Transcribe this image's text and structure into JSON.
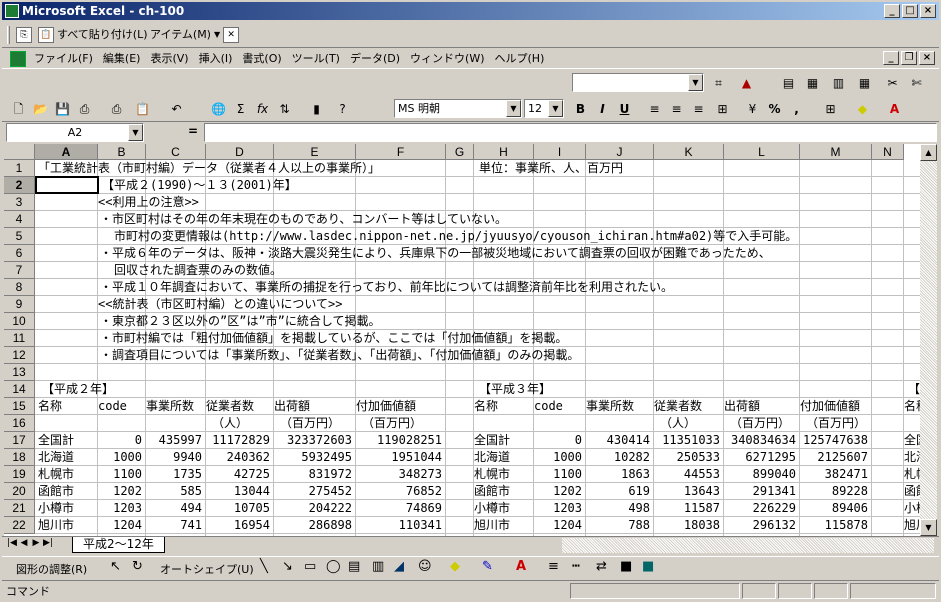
{
  "window": {
    "title": "Microsoft Excel - ch-100"
  },
  "clipboard_toolbar": {
    "paste_all": "すべて貼り付け(L)",
    "items": "アイテム(M)"
  },
  "menu": [
    "ファイル(F)",
    "編集(E)",
    "表示(V)",
    "挿入(I)",
    "書式(O)",
    "ツール(T)",
    "データ(D)",
    "ウィンドウ(W)",
    "ヘルプ(H)"
  ],
  "format_toolbar": {
    "font": "MS 明朝",
    "size": "12",
    "bold": "B",
    "italic": "I",
    "underline": "U",
    "percent": "%",
    "comma": ","
  },
  "formula_bar": {
    "name_box": "A2",
    "eq": "=",
    "value": ""
  },
  "columns": [
    "A",
    "B",
    "C",
    "D",
    "E",
    "F",
    "G",
    "H",
    "I",
    "J",
    "K",
    "L",
    "M",
    "N"
  ],
  "rows": [
    "1",
    "2",
    "3",
    "4",
    "5",
    "6",
    "7",
    "8",
    "9",
    "10",
    "11",
    "12",
    "13",
    "14",
    "15",
    "16",
    "17",
    "18",
    "19",
    "20",
    "21",
    "22"
  ],
  "text_lines": {
    "r1": "「工業統計表（市町村編）データ（従業者４人以上の事業所）」",
    "r1_unit": "単位：事業所、人、百万円",
    "r2": "【平成２(1990)～１３(2001)年】",
    "r3": "<<利用上の注意>>",
    "r4": "・市区町村はその年の年末現在のものであり、コンバート等はしていない。",
    "r5": "市町村の変更情報は(http://www.lasdec.nippon-net.ne.jp/jyuusyo/cyouson_ichiran.htm#a02)等で入手可能。",
    "r6": "・平成６年のデータは、阪神・淡路大震災発生により、兵庫県下の一部被災地域において調査票の回収が困難であったため、",
    "r7": "回収された調査票のみの数値。",
    "r8": "・平成１０年調査において、事業所の捕捉を行っており、前年比については調整済前年比を利用されたい。",
    "r9": "<<統計表（市区町村編）との違いについて>>",
    "r10": "・東京都２３区以外の”区”は”市”に統合して掲載。",
    "r11": "・市町村編では「粗付加価値額」を掲載しているが、ここでは「付加価値額」を掲載。",
    "r12": "・調査項目については「事業所数」、「従業者数」、「出荷額」、「付加価値額」のみの掲載。"
  },
  "block_h2": {
    "title": "【平成２年】",
    "headers": [
      "名称",
      "code",
      "事業所数",
      "従業者数",
      "出荷額",
      "付加価値額"
    ],
    "subheaders": [
      "",
      "",
      "",
      "（人）",
      "（百万円）",
      "（百万円）"
    ],
    "rows": [
      [
        "全国計",
        "0",
        "435997",
        "11172829",
        "323372603",
        "119028251"
      ],
      [
        "北海道",
        "1000",
        "9940",
        "240362",
        "5932495",
        "1951044"
      ],
      [
        "札幌市",
        "1100",
        "1735",
        "42725",
        "831972",
        "348273"
      ],
      [
        "函館市",
        "1202",
        "585",
        "13044",
        "275452",
        "76852"
      ],
      [
        "小樽市",
        "1203",
        "494",
        "10705",
        "204222",
        "74869"
      ],
      [
        "旭川市",
        "1204",
        "741",
        "16954",
        "286898",
        "110341"
      ]
    ]
  },
  "block_h3": {
    "title": "【平成３年】",
    "headers": [
      "名称",
      "code",
      "事業所数",
      "従業者数",
      "出荷額",
      "付加価値額",
      "名称"
    ],
    "subheaders": [
      "",
      "",
      "",
      "（人）",
      "（百万円）",
      "（百万円）"
    ],
    "rows": [
      [
        "全国計",
        "0",
        "430414",
        "11351033",
        "340834634",
        "125747638",
        "全国"
      ],
      [
        "北海道",
        "1000",
        "10282",
        "250533",
        "6271295",
        "2125607",
        "北海"
      ],
      [
        "札幌市",
        "1100",
        "1863",
        "44553",
        "899040",
        "382471",
        "札幌"
      ],
      [
        "函館市",
        "1202",
        "619",
        "13643",
        "291341",
        "89228",
        "函館"
      ],
      [
        "小樽市",
        "1203",
        "498",
        "11587",
        "226229",
        "89406",
        "小樽"
      ],
      [
        "旭川市",
        "1204",
        "788",
        "18038",
        "296132",
        "115878",
        "旭川"
      ]
    ],
    "next_title": "【平"
  },
  "sheet_tab": "平成2～12年",
  "draw_toolbar": {
    "draw_menu": "図形の調整(R)",
    "autoshape": "オートシェイプ(U)"
  },
  "status": {
    "mode": "コマンド"
  }
}
